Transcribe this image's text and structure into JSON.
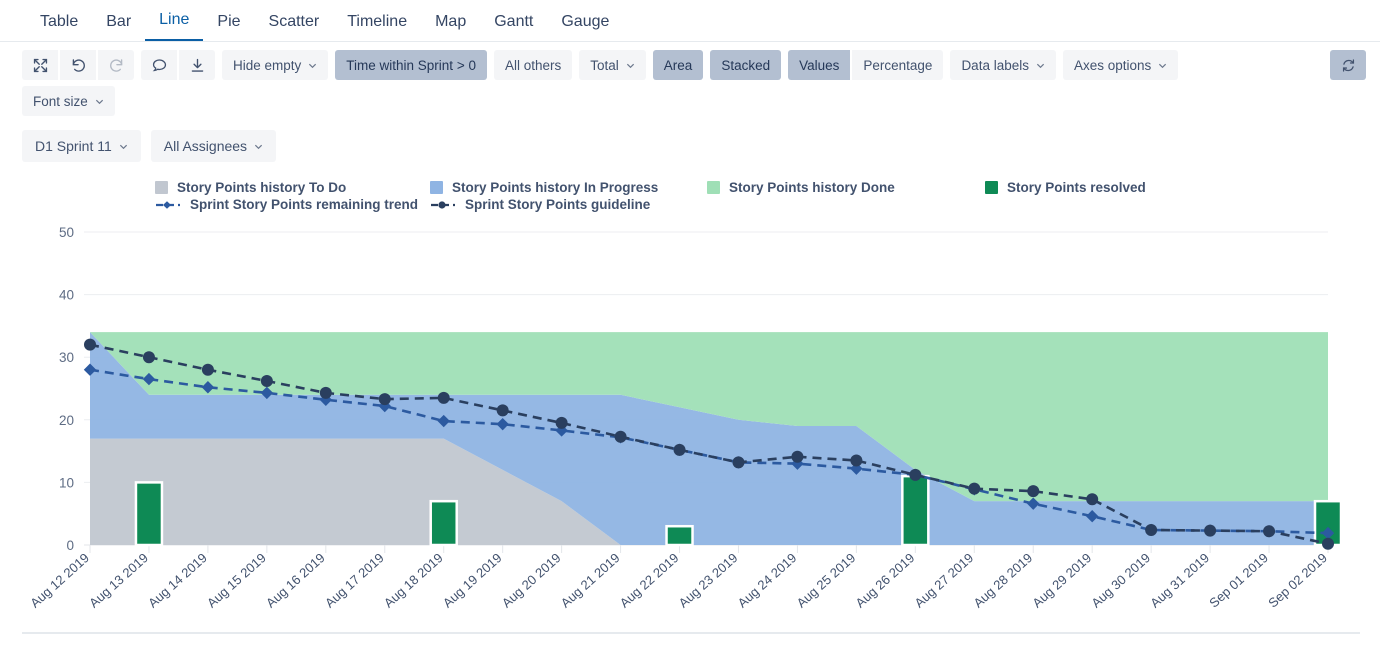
{
  "tabs": [
    {
      "label": "Table",
      "active": false
    },
    {
      "label": "Bar",
      "active": false
    },
    {
      "label": "Line",
      "active": true
    },
    {
      "label": "Pie",
      "active": false
    },
    {
      "label": "Scatter",
      "active": false
    },
    {
      "label": "Timeline",
      "active": false
    },
    {
      "label": "Map",
      "active": false
    },
    {
      "label": "Gantt",
      "active": false
    },
    {
      "label": "Gauge",
      "active": false
    }
  ],
  "toolbar": {
    "expand_icon": "expand-arrows-icon",
    "undo_icon": "undo-icon",
    "redo_icon": "redo-icon",
    "comment_icon": "comment-bubble-icon",
    "download_icon": "download-icon",
    "hide_empty": "Hide empty",
    "time_within_sprint": "Time within Sprint > 0",
    "all_others": "All others",
    "total": "Total",
    "area": "Area",
    "stacked": "Stacked",
    "values": "Values",
    "percentage": "Percentage",
    "data_labels": "Data labels",
    "axes_options": "Axes options",
    "font_size": "Font size",
    "refresh_icon": "refresh-icon"
  },
  "filters": {
    "sprint": "D1 Sprint 11",
    "assignees": "All Assignees"
  },
  "chart_data": {
    "type": "area",
    "title": "",
    "xlabel": "",
    "ylabel": "",
    "ylim": [
      0,
      50
    ],
    "yticks": [
      0,
      10,
      20,
      30,
      40,
      50
    ],
    "grid": true,
    "legend_position": "top",
    "categories": [
      "Aug 12 2019",
      "Aug 13 2019",
      "Aug 14 2019",
      "Aug 15 2019",
      "Aug 16 2019",
      "Aug 17 2019",
      "Aug 18 2019",
      "Aug 19 2019",
      "Aug 20 2019",
      "Aug 21 2019",
      "Aug 22 2019",
      "Aug 23 2019",
      "Aug 24 2019",
      "Aug 25 2019",
      "Aug 26 2019",
      "Aug 27 2019",
      "Aug 28 2019",
      "Aug 29 2019",
      "Aug 30 2019",
      "Aug 31 2019",
      "Sep 01 2019",
      "Sep 02 2019"
    ],
    "series": [
      {
        "name": "Story Points history To Do",
        "type": "area",
        "color": "#c1c7d0",
        "stack": "history",
        "values": [
          17,
          17,
          17,
          17,
          17,
          17,
          17,
          12,
          7,
          0,
          0,
          0,
          0,
          0,
          0,
          0,
          0,
          0,
          0,
          0,
          0,
          0
        ]
      },
      {
        "name": "Story Points history In Progress",
        "type": "area",
        "color": "#8fb4e3",
        "stack": "history",
        "values": [
          17,
          7,
          7,
          7,
          7,
          7,
          7,
          12,
          17,
          24,
          22,
          20,
          19,
          19,
          12,
          7,
          7,
          7,
          7,
          7,
          7,
          7
        ]
      },
      {
        "name": "Story Points history Done",
        "type": "area",
        "color": "#9fdfb6",
        "stack": "history",
        "values": [
          0,
          10,
          10,
          10,
          10,
          10,
          10,
          10,
          10,
          10,
          12,
          14,
          15,
          15,
          22,
          27,
          27,
          27,
          27,
          27,
          27,
          27
        ]
      },
      {
        "name": "Story Points resolved",
        "type": "bar",
        "color": "#0e8a55",
        "values": [
          0,
          10,
          0,
          0,
          0,
          0,
          7,
          0,
          0,
          0,
          3,
          0,
          0,
          0,
          11,
          0,
          0,
          0,
          0,
          0,
          0,
          7
        ]
      },
      {
        "name": "Sprint Story Points remaining trend",
        "type": "line",
        "color": "#2c5aa0",
        "marker": "diamond",
        "dashed": true,
        "values": [
          28,
          26.5,
          25.2,
          24.3,
          23.2,
          22.2,
          19.8,
          19.3,
          18.3,
          17.2,
          15.2,
          13.2,
          13.0,
          12.2,
          11.2,
          8.9,
          6.6,
          4.6,
          2.4,
          2.3,
          2.2,
          1.9
        ]
      },
      {
        "name": "Sprint Story Points guideline",
        "type": "line",
        "color": "#2a3f5f",
        "marker": "circle",
        "dashed": true,
        "values": [
          32,
          30,
          28,
          26.2,
          24.3,
          23.3,
          23.5,
          21.5,
          19.5,
          17.3,
          15.2,
          13.2,
          14.1,
          13.5,
          11.2,
          9.0,
          8.6,
          7.3,
          2.4,
          2.3,
          2.2,
          0.2
        ]
      }
    ]
  },
  "legend": [
    {
      "label": "Story Points history To Do",
      "color": "#c1c7d0",
      "kind": "swatch"
    },
    {
      "label": "Story Points history In Progress",
      "color": "#8fb4e3",
      "kind": "swatch"
    },
    {
      "label": "Story Points history Done",
      "color": "#9fdfb6",
      "kind": "swatch"
    },
    {
      "label": "Story Points resolved",
      "color": "#0e8a55",
      "kind": "swatch"
    },
    {
      "label": "Sprint Story Points remaining trend",
      "color": "#2c5aa0",
      "kind": "line-diamond"
    },
    {
      "label": "Sprint Story Points guideline",
      "color": "#2a3f5f",
      "kind": "line-circle"
    }
  ]
}
